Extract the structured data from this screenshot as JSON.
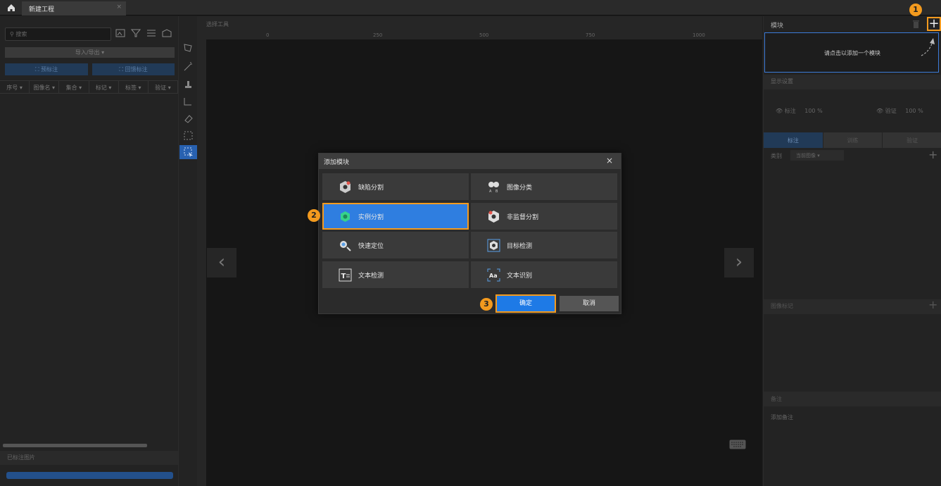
{
  "titlebar": {
    "tab_label": "新建工程",
    "tab_close": "×"
  },
  "left_panel": {
    "search_placeholder": "搜索",
    "import_export": "导入/导出 ▾",
    "pre_label": "预标注",
    "review_label": "回馈标注",
    "columns": [
      "序号 ▾",
      "图像名 ▾",
      "集合 ▾",
      "标记 ▾",
      "标签 ▾",
      "验证 ▾"
    ],
    "labeled_images": "已标注图片"
  },
  "canvas": {
    "selection_tool_label": "选择工具",
    "ruler_ticks": [
      "0",
      "250",
      "500",
      "750",
      "1000"
    ],
    "nav_prev": "‹",
    "nav_next": "›"
  },
  "right_panel": {
    "modules_title": "模块",
    "add_module_symbol": "+",
    "module_hint": "请点击以添加一个模块",
    "display_settings": "显示设置",
    "label_visibility": {
      "label": "标注",
      "value": "100 %"
    },
    "verify_visibility": {
      "label": "验证",
      "value": "100 %"
    },
    "tabs": [
      "标注",
      "训练",
      "验证"
    ],
    "category_label": "类别",
    "category_value": "当前图像",
    "image_tags": "图像标记",
    "notes_title": "备注",
    "add_notes": "添加备注"
  },
  "dialog": {
    "title": "添加模块",
    "close": "×",
    "modules": [
      {
        "label": "缺陷分割",
        "icon": "defect-segmentation-icon"
      },
      {
        "label": "图像分类",
        "icon": "image-classification-icon"
      },
      {
        "label": "实例分割",
        "icon": "instance-segmentation-icon"
      },
      {
        "label": "非监督分割",
        "icon": "unsupervised-segmentation-icon"
      },
      {
        "label": "快速定位",
        "icon": "fast-positioning-icon"
      },
      {
        "label": "目标检测",
        "icon": "object-detection-icon"
      },
      {
        "label": "文本检测",
        "icon": "text-detection-icon"
      },
      {
        "label": "文本识别",
        "icon": "text-recognition-icon"
      }
    ],
    "selected_module": "实例分割",
    "confirm": "确定",
    "cancel": "取消"
  },
  "steps": [
    "1",
    "2",
    "3"
  ],
  "colors": {
    "highlight": "#f39a1e",
    "selected": "#2f7ee0",
    "primary": "#1e7ae6"
  }
}
